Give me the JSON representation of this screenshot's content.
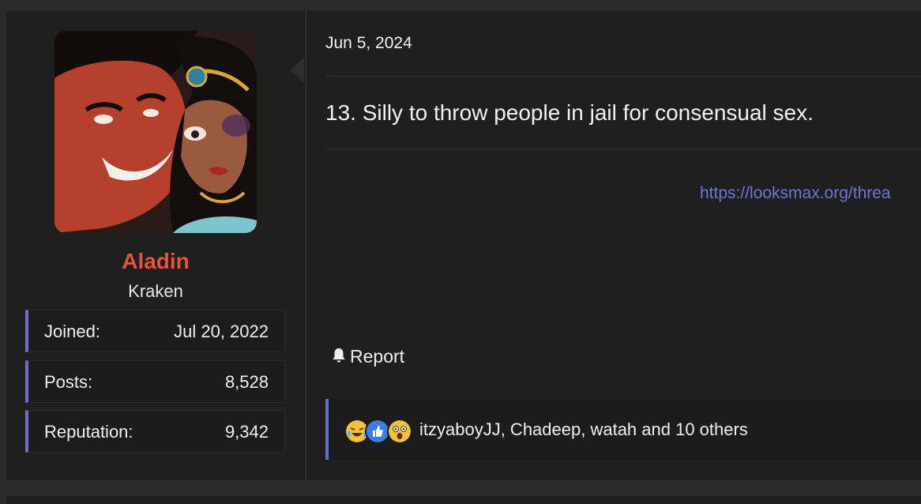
{
  "post": {
    "date": "Jun 5, 2024",
    "content": "13. Silly to throw people in jail for consensual sex.",
    "link": "https://looksmax.org/threa",
    "report_label": "Report"
  },
  "user": {
    "name": "Aladin",
    "title": "Kraken",
    "stats": [
      {
        "label": "Joined:",
        "value": "Jul 20, 2022"
      },
      {
        "label": "Posts:",
        "value": "8,528"
      },
      {
        "label": "Reputation:",
        "value": "9,342"
      }
    ]
  },
  "reactions": {
    "icons": [
      "crying-laughing-emoji-icon",
      "thumbs-up-icon",
      "shocked-emoji-icon"
    ],
    "summary": "itzyaboyJJ, Chadeep, watah and 10 others"
  },
  "colors": {
    "username": "#e5533d",
    "accent": "#6a70c8",
    "link": "#6f76cf"
  }
}
